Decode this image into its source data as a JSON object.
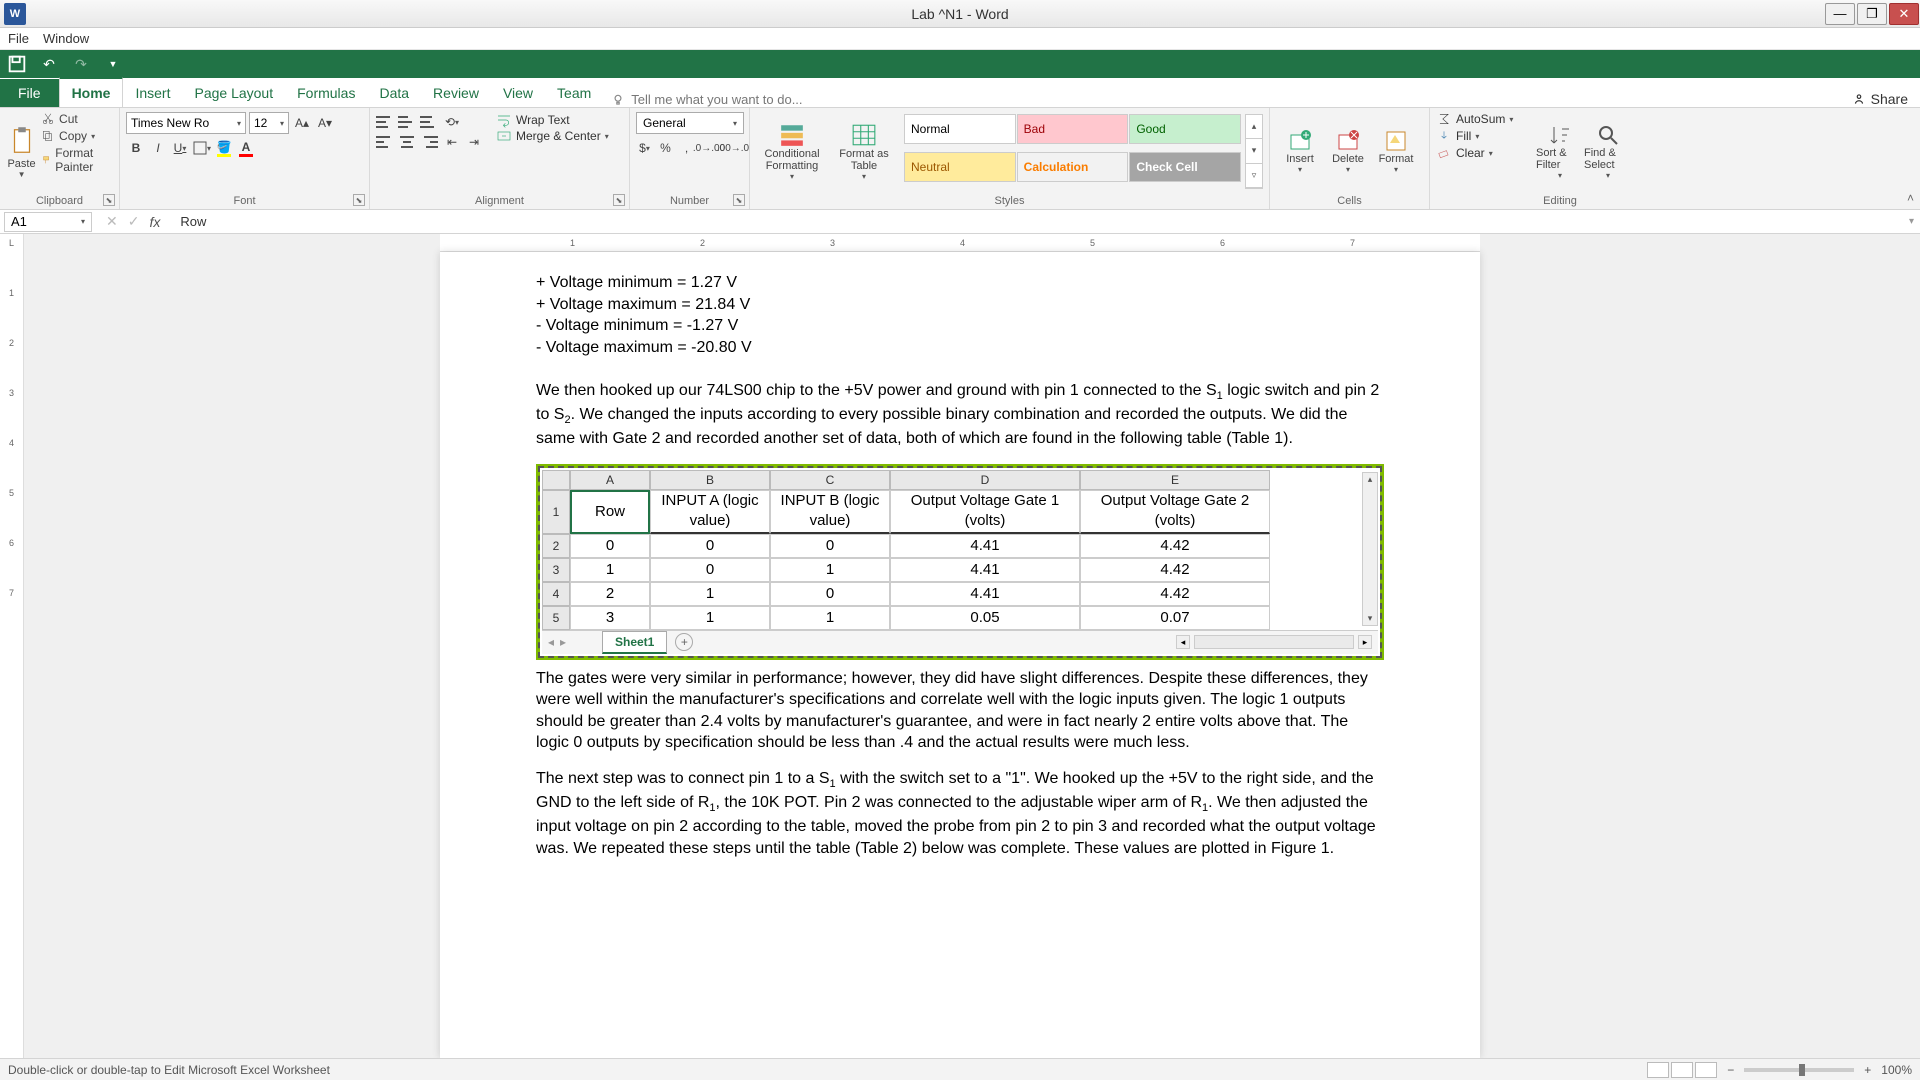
{
  "window": {
    "title": "Lab ^N1 - Word",
    "app_icon_label": "W"
  },
  "menu": {
    "file": "File",
    "window": "Window"
  },
  "ribbon": {
    "file_tab": "File",
    "tabs": [
      "Home",
      "Insert",
      "Page Layout",
      "Formulas",
      "Data",
      "Review",
      "View",
      "Team"
    ],
    "active_tab": "Home",
    "tell_me": "Tell me what you want to do...",
    "share": "Share"
  },
  "clipboard": {
    "paste": "Paste",
    "cut": "Cut",
    "copy": "Copy",
    "painter": "Format Painter",
    "group": "Clipboard"
  },
  "font": {
    "name": "Times New Ro",
    "size": "12",
    "group": "Font"
  },
  "alignment": {
    "wrap": "Wrap Text",
    "merge": "Merge & Center",
    "group": "Alignment"
  },
  "number": {
    "format": "General",
    "group": "Number"
  },
  "styles": {
    "conditional": "Conditional Formatting",
    "format_as": "Format as Table",
    "normal": "Normal",
    "bad": "Bad",
    "good": "Good",
    "neutral": "Neutral",
    "calculation": "Calculation",
    "check_cell": "Check Cell",
    "group": "Styles"
  },
  "cells": {
    "insert": "Insert",
    "delete": "Delete",
    "format": "Format",
    "group": "Cells"
  },
  "editing": {
    "autosum": "AutoSum",
    "fill": "Fill",
    "clear": "Clear",
    "sort": "Sort & Filter",
    "find": "Find & Select",
    "group": "Editing"
  },
  "formula_bar": {
    "name_box": "A1",
    "fx_value": "Row"
  },
  "document": {
    "voltage_lines": [
      "+ Voltage minimum = 1.27 V",
      "+ Voltage maximum = 21.84 V",
      "- Voltage minimum = -1.27 V",
      "- Voltage maximum = -20.80 V"
    ],
    "para1_a": "We then hooked up our 74LS00 chip to the +5V power and ground with pin 1 connected to the S",
    "para1_b": " logic switch and pin 2 to S",
    "para1_c": ". We changed the inputs according to every possible binary combination and recorded the outputs. We did the same with Gate 2 and recorded another set of data, both of which are found in the following table (Table 1).",
    "para2": "The gates were very similar in performance; however, they did have slight differences. Despite these differences, they were well within the manufacturer's specifications and correlate well with the logic inputs given. The logic 1 outputs should be greater than 2.4 volts by manufacturer's guarantee, and were in fact nearly 2 entire volts above that. The logic 0 outputs by specification should be less than .4 and the actual results were much less.",
    "para3_a": "The next step was to connect pin 1 to a S",
    "para3_b": " with the switch set to a \"1\". We hooked up the +5V to the right side, and the GND to the left side of R",
    "para3_c": ", the 10K POT. Pin 2 was connected to the adjustable wiper arm of R",
    "para3_d": ". We then adjusted the input voltage on pin 2 according to the table, moved the probe from pin 2 to pin 3 and recorded what the output voltage was. We repeated these steps until the table (Table 2) below was complete. These values are plotted in Figure 1."
  },
  "chart_data": {
    "type": "table",
    "columns": [
      "A",
      "B",
      "C",
      "D",
      "E"
    ],
    "header_row": {
      "A": "Row",
      "B": "INPUT A (logic value)",
      "C": "INPUT B (logic value)",
      "D": "Output Voltage Gate 1 (volts)",
      "E": "Output Voltage Gate 2 (volts)"
    },
    "rows": [
      {
        "num": "2",
        "A": "0",
        "B": "0",
        "C": "0",
        "D": "4.41",
        "E": "4.42"
      },
      {
        "num": "3",
        "A": "1",
        "B": "0",
        "C": "1",
        "D": "4.41",
        "E": "4.42"
      },
      {
        "num": "4",
        "A": "2",
        "B": "1",
        "C": "0",
        "D": "4.41",
        "E": "4.42"
      },
      {
        "num": "5",
        "A": "3",
        "B": "1",
        "C": "1",
        "D": "0.05",
        "E": "0.07"
      }
    ],
    "sheet_tab": "Sheet1"
  },
  "status": {
    "message": "Double-click or double-tap to Edit Microsoft Excel Worksheet",
    "zoom": "100%"
  },
  "ruler_top": [
    "1",
    "2",
    "3",
    "4",
    "5",
    "6",
    "7"
  ],
  "ruler_left": [
    "L",
    "",
    "1",
    "",
    "2",
    "",
    "3",
    "",
    "4",
    "",
    "5",
    "",
    "6",
    "",
    "7"
  ]
}
